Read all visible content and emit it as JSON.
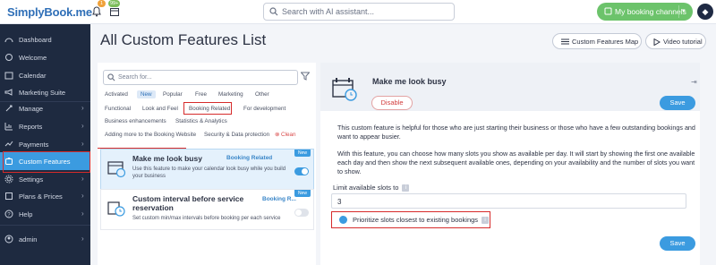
{
  "topbar": {
    "logo": "SimplyBook.me",
    "notifications_count": "1",
    "calendar_count": "99+",
    "search_placeholder": "Search with AI assistant...",
    "channels_label": "My booking channels"
  },
  "sidebar": {
    "items": [
      {
        "label": "Dashboard",
        "icon": "dashboard-icon"
      },
      {
        "label": "Welcome",
        "icon": "welcome-icon"
      },
      {
        "label": "Calendar",
        "icon": "calendar-icon"
      },
      {
        "label": "Marketing Suite",
        "icon": "megaphone-icon"
      },
      {
        "label": "Manage",
        "icon": "manage-icon"
      },
      {
        "label": "Reports",
        "icon": "reports-icon"
      },
      {
        "label": "Payments",
        "icon": "payments-icon"
      },
      {
        "label": "Custom Features",
        "icon": "puzzle-icon"
      },
      {
        "label": "Settings",
        "icon": "gear-icon"
      },
      {
        "label": "Plans & Prices",
        "icon": "plans-icon"
      },
      {
        "label": "Help",
        "icon": "help-icon"
      },
      {
        "label": "admin",
        "icon": "user-icon"
      }
    ]
  },
  "main": {
    "title": "All Custom Features List",
    "map_button": "Custom Features Map",
    "video_button": "Video tutorial"
  },
  "filters": {
    "search_placeholder": "Search for...",
    "chips": [
      "Activated",
      "New",
      "Popular",
      "Free",
      "Marketing",
      "Other",
      "Functional",
      "Look and Feel",
      "Booking Related",
      "For development",
      "Business enhancements",
      "Statistics & Analytics",
      "Adding more to the Booking Website",
      "Security & Data protection",
      "Clean"
    ]
  },
  "features": [
    {
      "title": "Make me look busy",
      "tag": "Booking Related",
      "badge": "New",
      "desc": "Use this feature to make your calendar look busy while you build your business",
      "enabled": true
    },
    {
      "title": "Custom interval before service reservation",
      "tag": "Booking R...",
      "badge": "New",
      "desc": "Set custom min/max intervals before booking per each service",
      "enabled": false
    }
  ],
  "detail": {
    "title": "Make me look busy",
    "disable_label": "Disable",
    "save_label": "Save",
    "para1": "This custom feature is helpful for those who are just starting their business or those who have a few outstanding bookings and want to appear busier.",
    "para2": "With this feature, you can choose how many slots you show as available per day. It will start by showing the first one available each day and then show the next subsequent available ones, depending on your availability and the number of slots you want to show.",
    "setting_label": "Limit available slots to",
    "setting_value": "3",
    "radio_label": "Prioritize slots closest to existing bookings"
  },
  "colors": {
    "accent": "#3b9be0",
    "sidebar": "#1e2a40",
    "highlight": "#d62b2b",
    "green": "#6cc36b"
  }
}
